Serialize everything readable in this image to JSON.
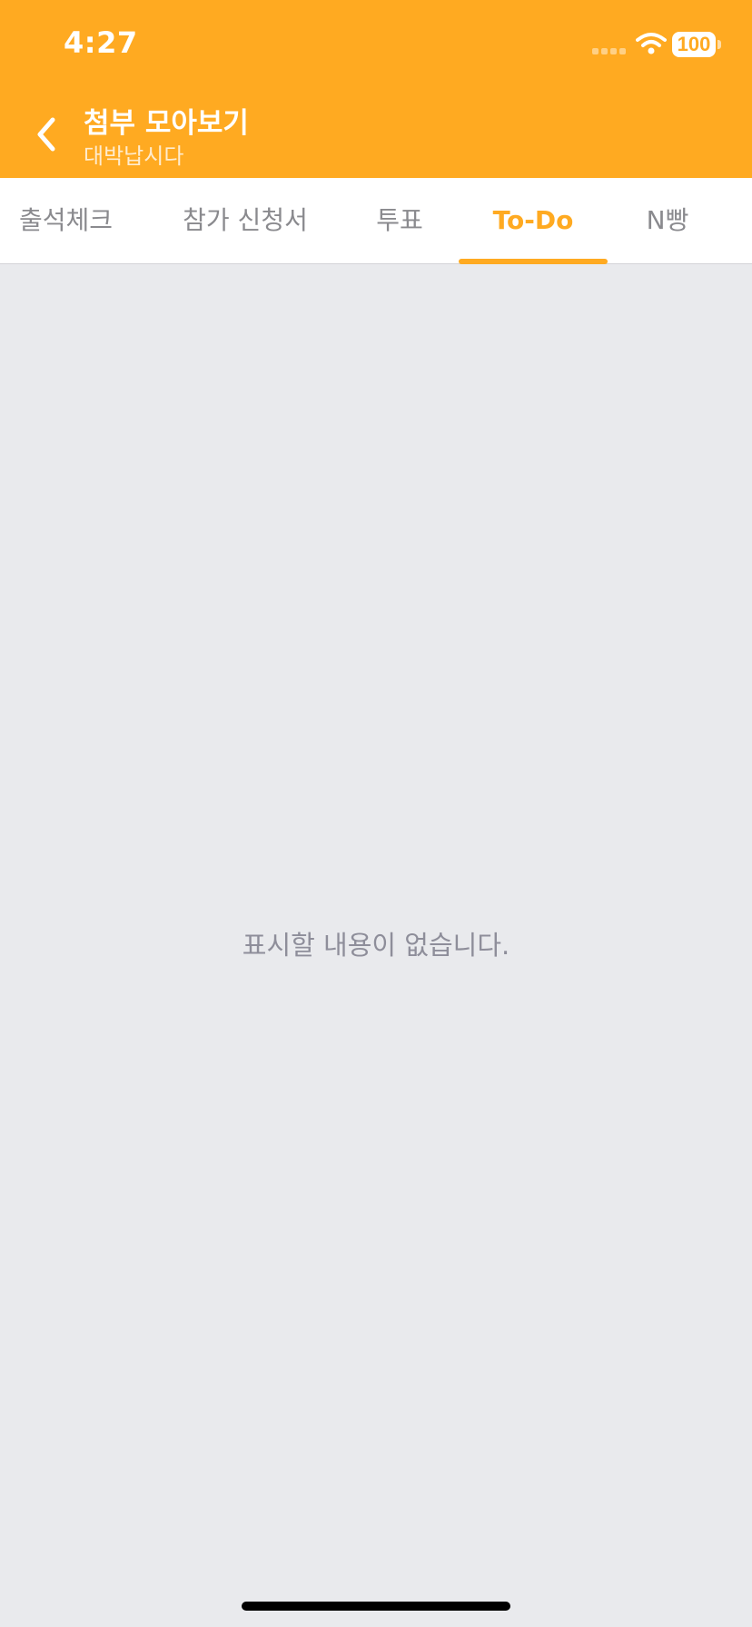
{
  "status_bar": {
    "time": "4:27",
    "battery": "100",
    "icons": [
      "signal-icon",
      "wifi-icon",
      "battery-icon"
    ]
  },
  "nav": {
    "back_icon": "chevron-left-icon",
    "title": "첨부 모아보기",
    "subtitle": "대박납시다"
  },
  "tabs": [
    {
      "label": "출석체크"
    },
    {
      "label": "참가 신청서"
    },
    {
      "label": "투표"
    },
    {
      "label": "To-Do"
    },
    {
      "label": "N빵"
    }
  ],
  "active_tab": "To-Do",
  "empty_state": {
    "message": "표시할 내용이 없습니다."
  },
  "colors": {
    "accent": "#FFAA21",
    "background": "#E9EAED",
    "tab_inactive": "#8A8A8E",
    "empty_text": "#8E8E9A"
  }
}
